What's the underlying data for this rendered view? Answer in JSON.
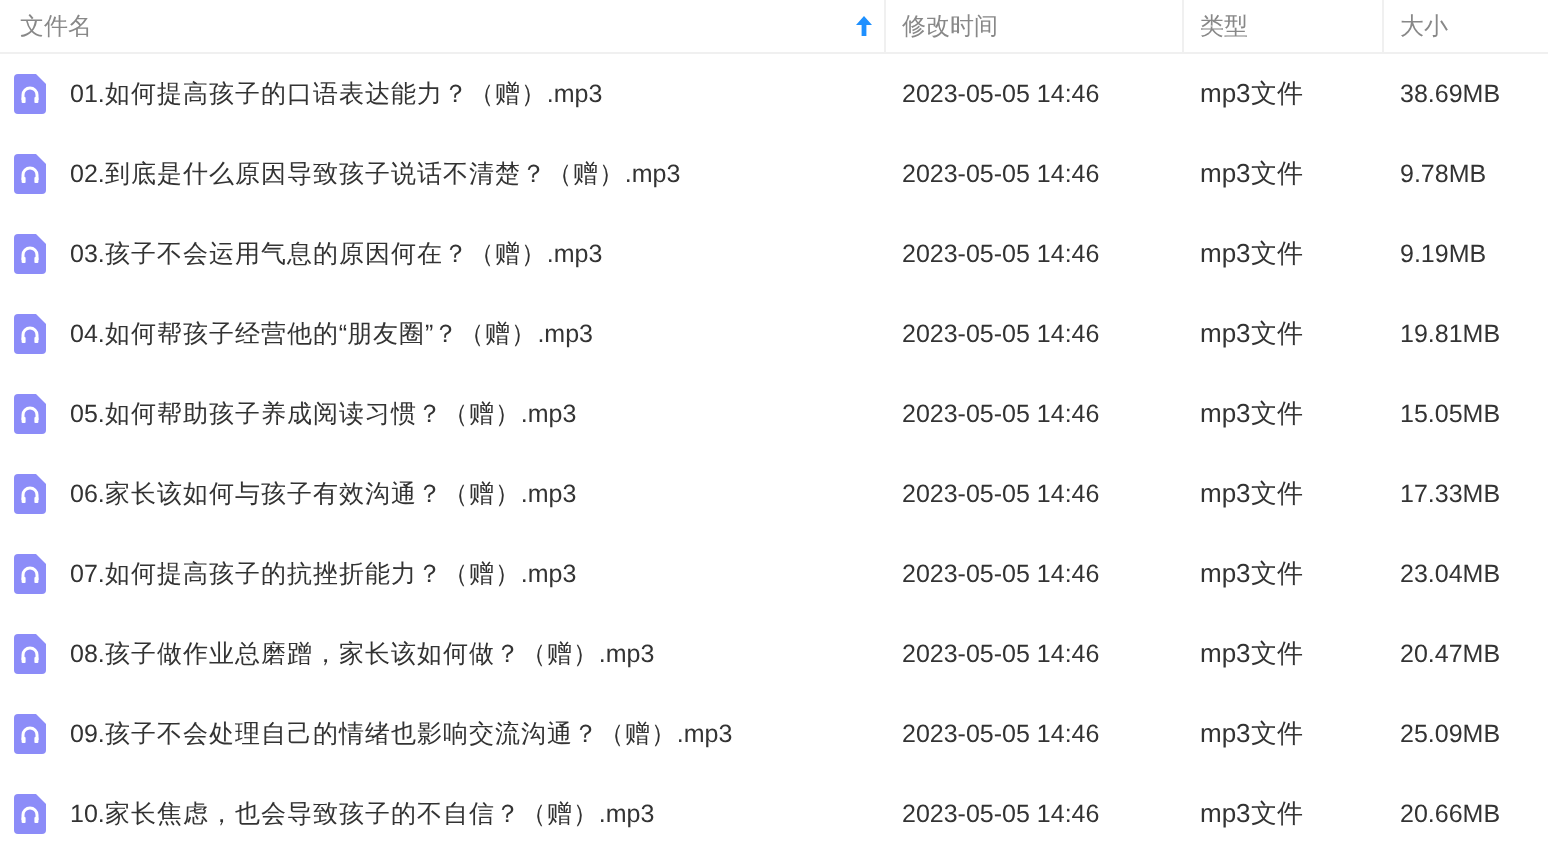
{
  "table": {
    "columns": [
      {
        "label": "文件名",
        "sorted": true
      },
      {
        "label": "修改时间",
        "sorted": false
      },
      {
        "label": "类型",
        "sorted": false
      },
      {
        "label": "大小",
        "sorted": false
      }
    ],
    "rows": [
      {
        "name": "01.如何提高孩子的口语表达能力？（赠）.mp3",
        "modified": "2023-05-05 14:46",
        "type": "mp3文件",
        "size": "38.69MB"
      },
      {
        "name": "02.到底是什么原因导致孩子说话不清楚？（赠）.mp3",
        "modified": "2023-05-05 14:46",
        "type": "mp3文件",
        "size": "9.78MB"
      },
      {
        "name": "03.孩子不会运用气息的原因何在？（赠）.mp3",
        "modified": "2023-05-05 14:46",
        "type": "mp3文件",
        "size": "9.19MB"
      },
      {
        "name": "04.如何帮孩子经营他的“朋友圈”？（赠）.mp3",
        "modified": "2023-05-05 14:46",
        "type": "mp3文件",
        "size": "19.81MB"
      },
      {
        "name": "05.如何帮助孩子养成阅读习惯？（赠）.mp3",
        "modified": "2023-05-05 14:46",
        "type": "mp3文件",
        "size": "15.05MB"
      },
      {
        "name": "06.家长该如何与孩子有效沟通？（赠）.mp3",
        "modified": "2023-05-05 14:46",
        "type": "mp3文件",
        "size": "17.33MB"
      },
      {
        "name": "07.如何提高孩子的抗挫折能力？（赠）.mp3",
        "modified": "2023-05-05 14:46",
        "type": "mp3文件",
        "size": "23.04MB"
      },
      {
        "name": "08.孩子做作业总磨蹭，家长该如何做？（赠）.mp3",
        "modified": "2023-05-05 14:46",
        "type": "mp3文件",
        "size": "20.47MB"
      },
      {
        "name": "09.孩子不会处理自己的情绪也影响交流沟通？（赠）.mp3",
        "modified": "2023-05-05 14:46",
        "type": "mp3文件",
        "size": "25.09MB"
      },
      {
        "name": "10.家长焦虑，也会导致孩子的不自信？（赠）.mp3",
        "modified": "2023-05-05 14:46",
        "type": "mp3文件",
        "size": "20.66MB"
      }
    ]
  }
}
